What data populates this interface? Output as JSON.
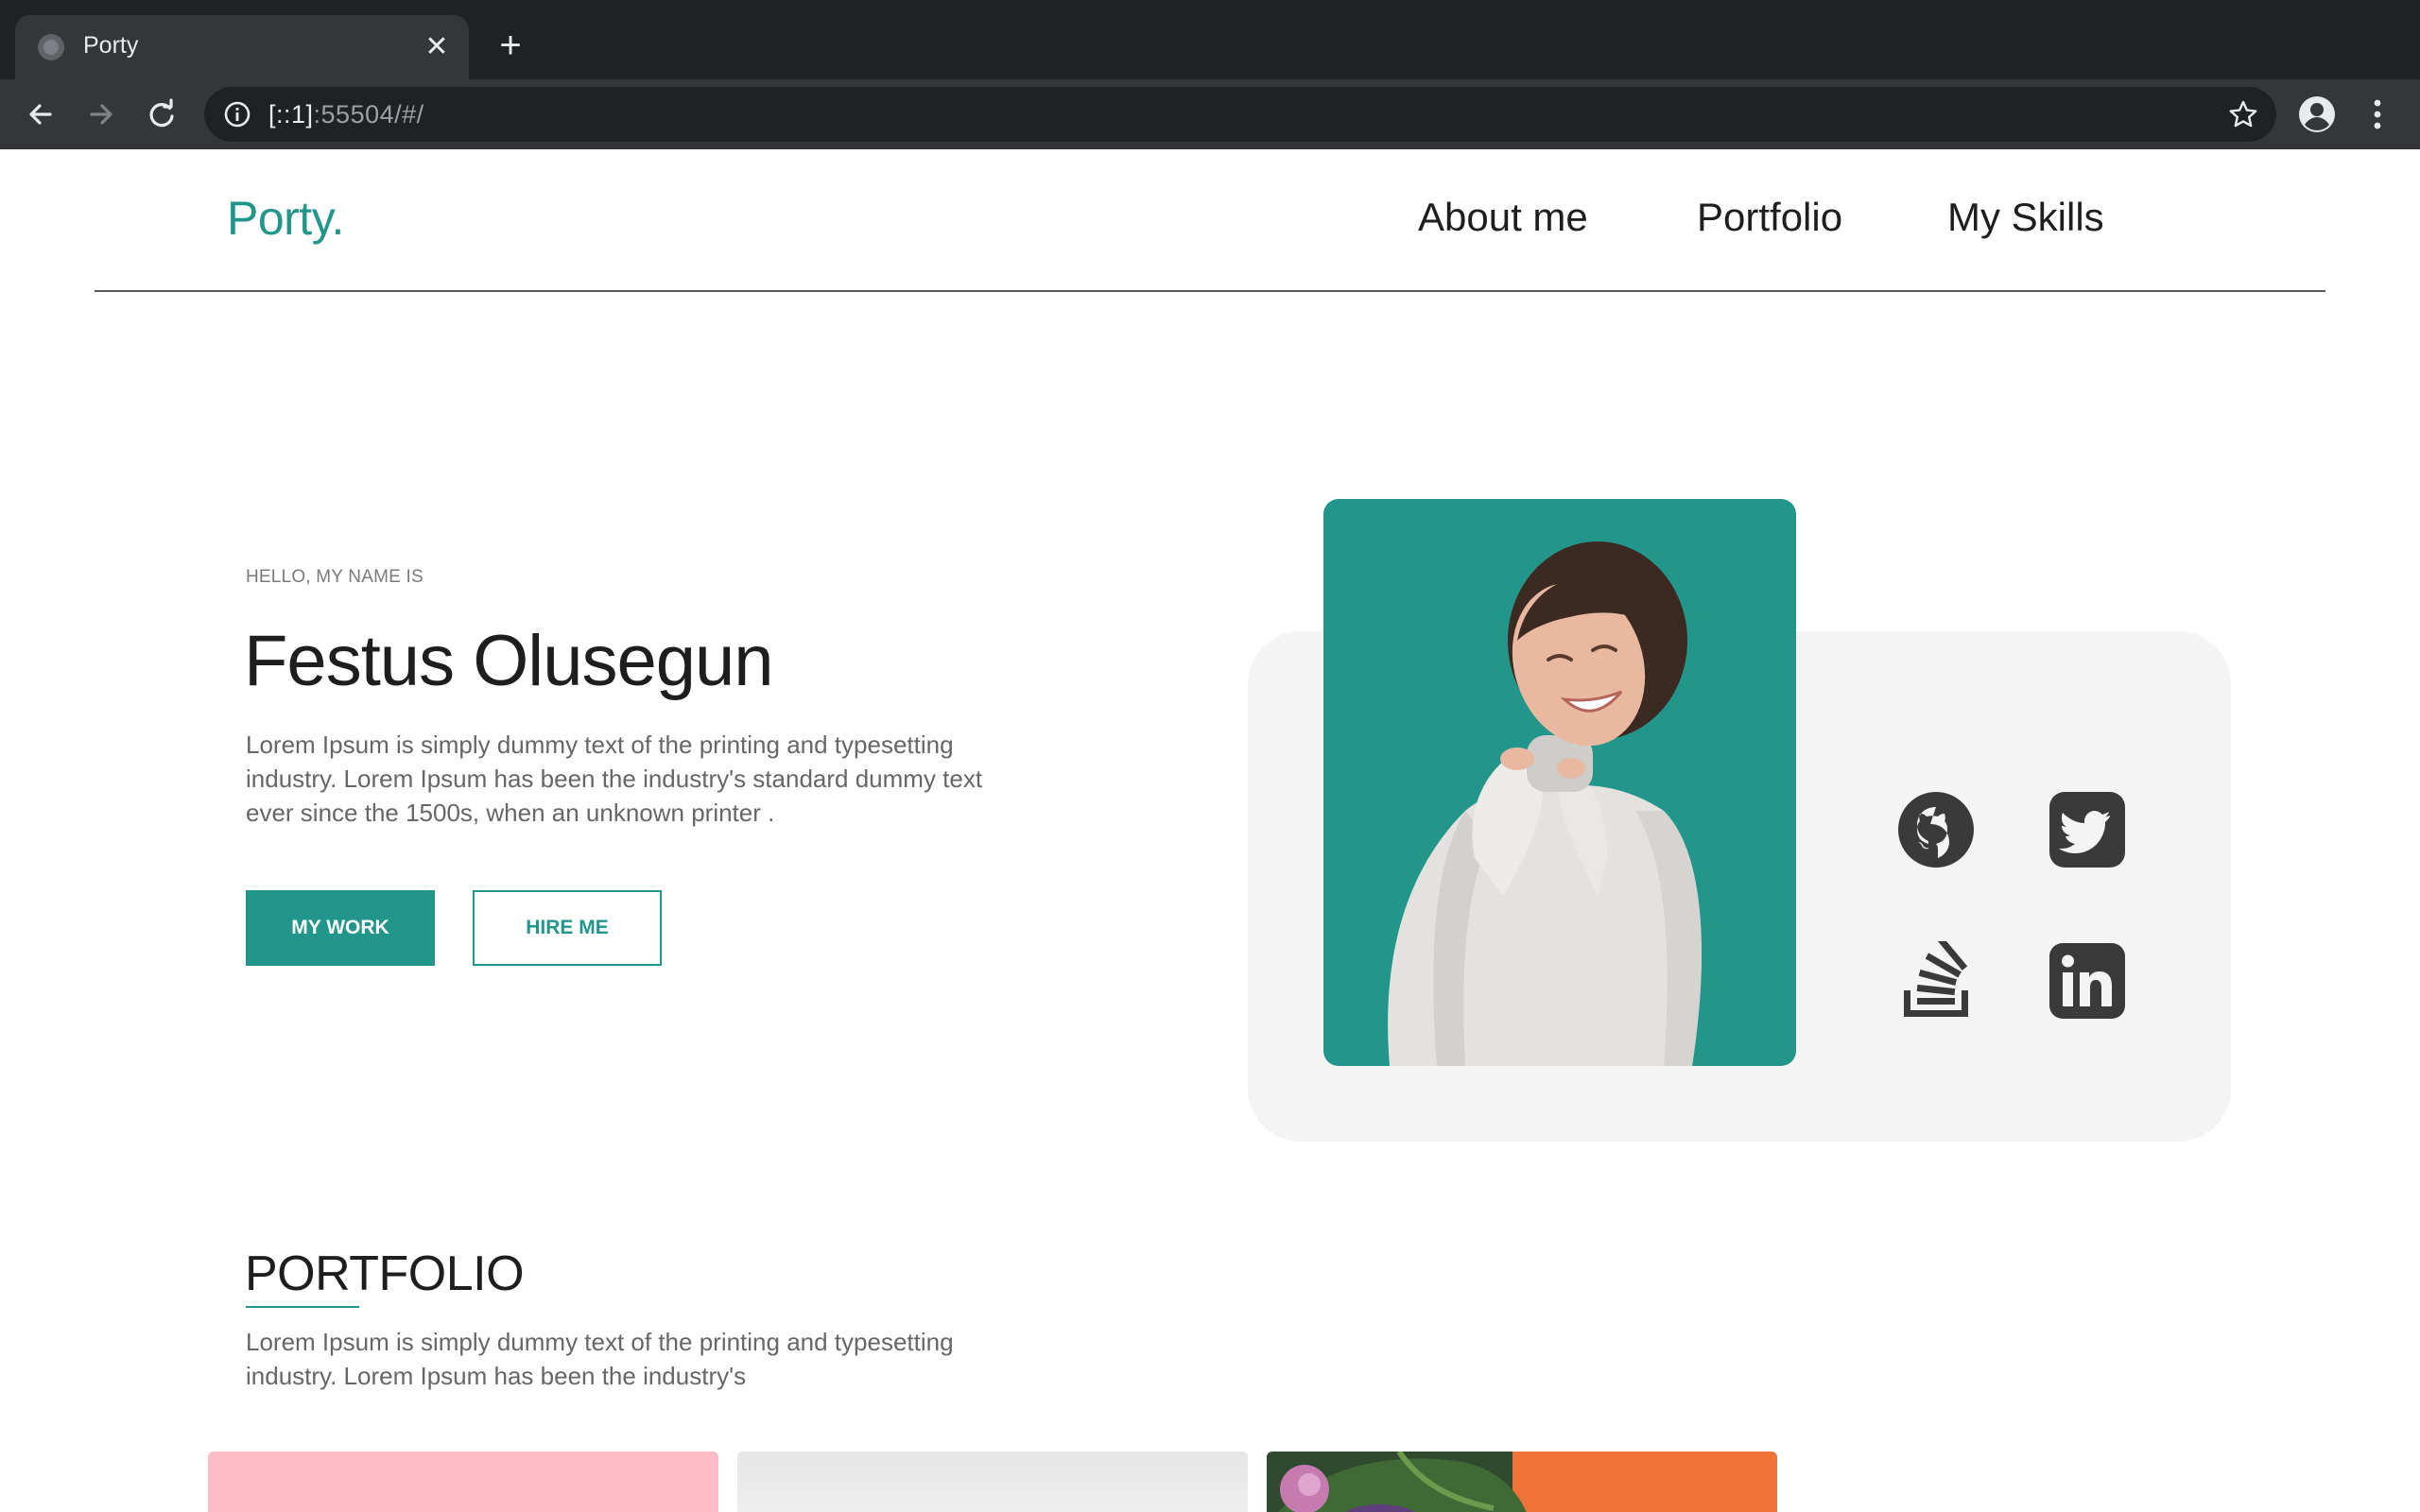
{
  "browser": {
    "tab_title": "Porty",
    "url_host": "[::1]",
    "url_rest": ":55504/#/"
  },
  "site": {
    "logo": "Porty.",
    "nav": [
      "About me",
      "Portfolio",
      "My Skills"
    ]
  },
  "hero": {
    "eyebrow": "HELLO, MY NAME IS",
    "name": "Festus Olusegun",
    "description": "Lorem Ipsum is simply dummy text of the printing and typesetting industry. Lorem Ipsum has been the industry's standard dummy text ever since the 1500s, when an unknown printer .",
    "primary_button": "MY WORK",
    "secondary_button": "HIRE ME",
    "social_icons": [
      "github-icon",
      "twitter-icon",
      "stackoverflow-icon",
      "linkedin-icon"
    ]
  },
  "portfolio": {
    "title": "PORTFOLIO",
    "description": "Lorem Ipsum is simply dummy text of the printing and typesetting industry. Lorem Ipsum has been the industry's"
  },
  "colors": {
    "accent": "#22968a",
    "text_dark": "#1e1e1e",
    "text_muted": "#666666",
    "card_bg": "#f4f4f4",
    "chrome_dark": "#202124",
    "chrome_mid": "#35363a"
  }
}
